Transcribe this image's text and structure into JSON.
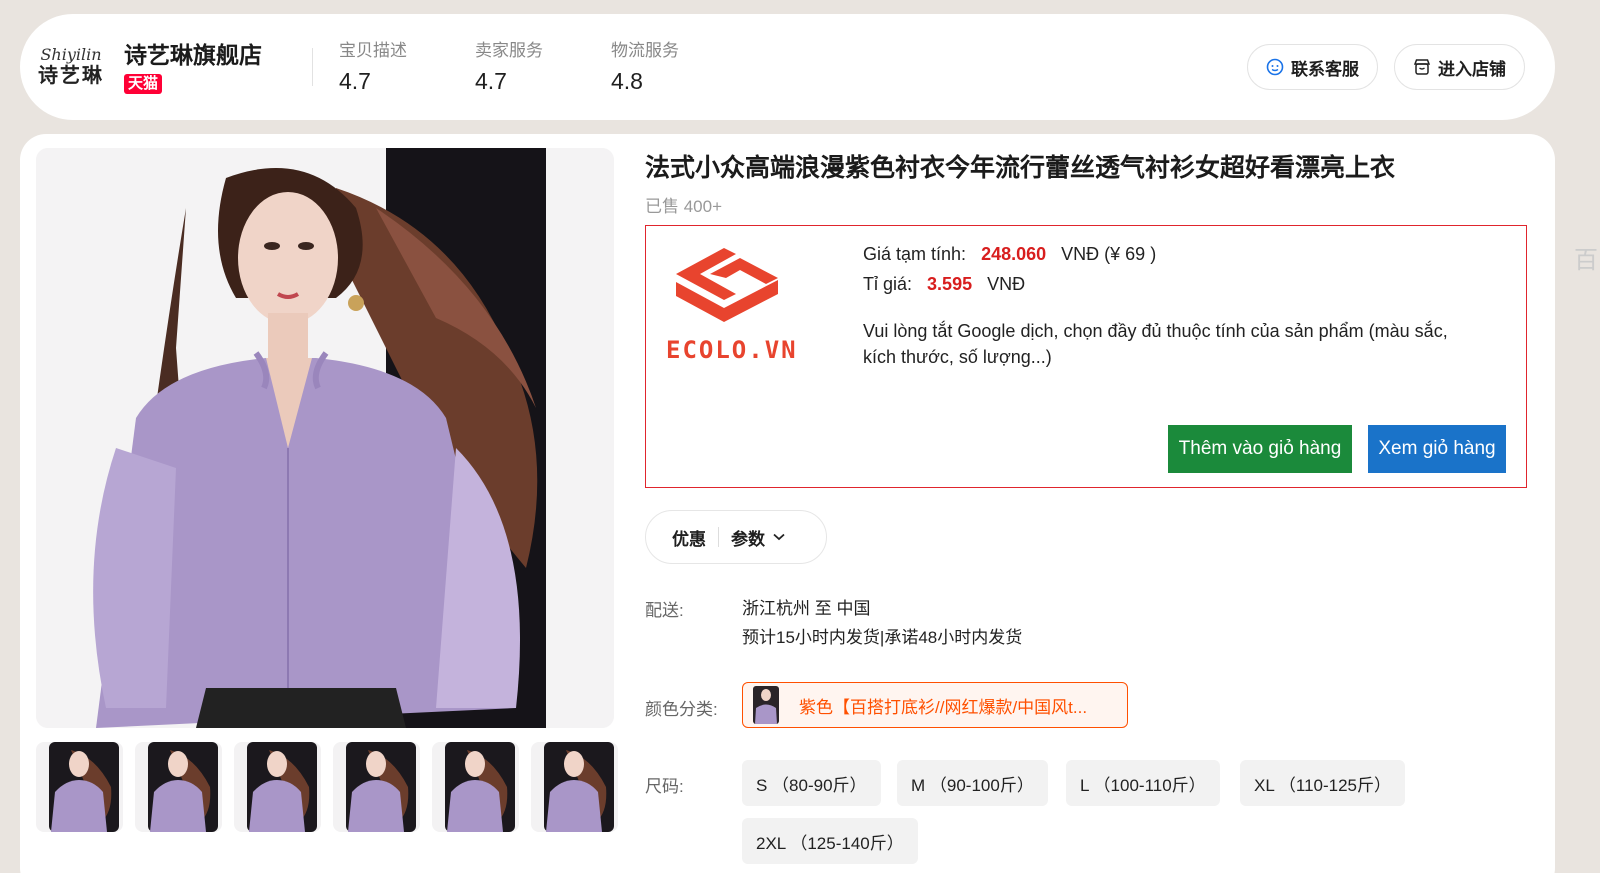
{
  "store": {
    "logo_script": "Shiyilin",
    "logo_cn": "诗艺琳",
    "name": "诗艺琳旗舰店",
    "badge": "天猫",
    "ratings": [
      {
        "label": "宝贝描述",
        "value": "4.7"
      },
      {
        "label": "卖家服务",
        "value": "4.7"
      },
      {
        "label": "物流服务",
        "value": "4.8"
      }
    ],
    "contact_button": "联系客服",
    "shop_button": "进入店铺"
  },
  "product": {
    "title": "法式小众高端浪漫紫色衬衣今年流行蕾丝透气衬衫女超好看漂亮上衣",
    "sold": "已售 400+"
  },
  "ecolo": {
    "brand": "ECOLO.VN",
    "price_label": "Giá tạm tính:",
    "price_value": "248.060",
    "price_suffix": "VNĐ (¥ 69 )",
    "rate_label": "Tỉ giá:",
    "rate_value": "3.595",
    "rate_suffix": "VNĐ",
    "notice": "Vui lòng tắt Google dịch, chọn đầy đủ thuộc tính của sản phẩm (màu sắc, kích thước, số lượng...)",
    "add_to_cart": "Thêm vào giỏ hàng",
    "view_cart": "Xem giỏ hàng",
    "brand_color": "#e8442e"
  },
  "tabs": {
    "promo": "优惠",
    "params": "参数"
  },
  "shipping": {
    "label": "配送:",
    "route": "浙江杭州 至 中国",
    "time": "预计15小时内发货|承诺48小时内发货"
  },
  "color": {
    "label": "颜色分类:",
    "selected": "紫色【百搭打底衫//网红爆款/中国风t..."
  },
  "size": {
    "label": "尺码:",
    "options": [
      "S （80-90斤）",
      "M （90-100斤）",
      "L （100-110斤）",
      "XL （110-125斤）",
      "2XL （125-140斤）"
    ]
  },
  "edge_glyph": "百"
}
